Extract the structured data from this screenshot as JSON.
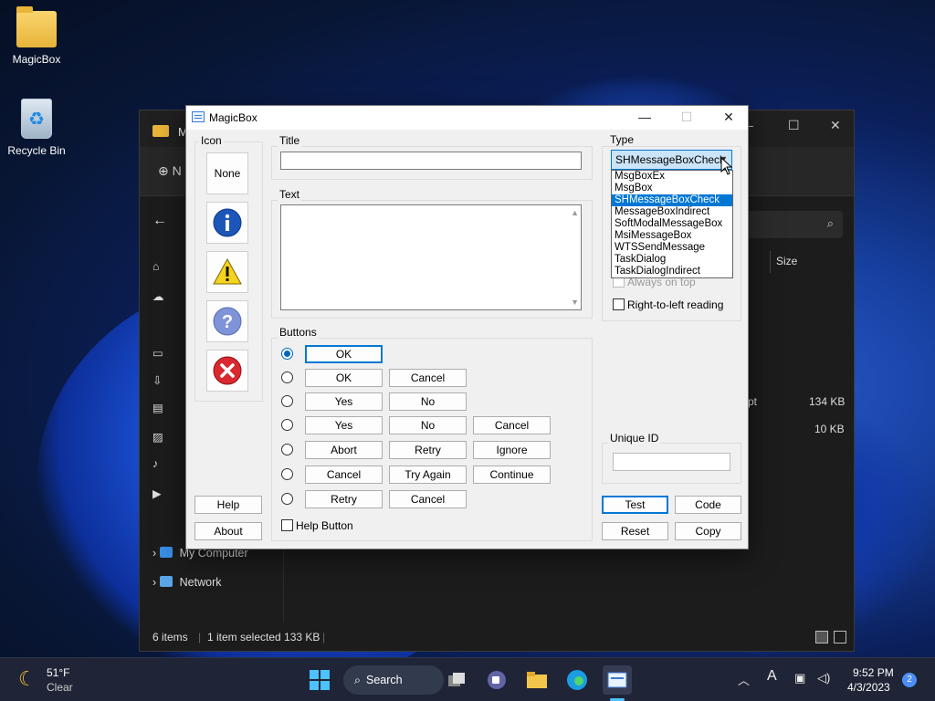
{
  "desktop": {
    "icons": [
      {
        "label": "MagicBox"
      },
      {
        "label": "Recycle Bin"
      }
    ]
  },
  "explorer": {
    "tab_title": "M",
    "new_label": "N",
    "sidebar": [
      "My Computer",
      "Network"
    ],
    "column_size": "Size",
    "rows": [
      {
        "type_partial": "pt",
        "size": "134 KB"
      },
      {
        "type_partial": "",
        "size": "10 KB"
      }
    ],
    "status": {
      "items": "6 items",
      "selected": "1 item selected  133 KB"
    }
  },
  "dialog": {
    "title": "MagicBox",
    "icon_group": "Icon",
    "icon_buttons": [
      {
        "label": "None"
      },
      {
        "icon": "info-icon"
      },
      {
        "icon": "warning-icon"
      },
      {
        "icon": "question-icon"
      },
      {
        "icon": "error-icon"
      }
    ],
    "help_label": "Help",
    "about_label": "About",
    "title_group": "Title",
    "title_value": "",
    "text_group": "Text",
    "text_value": "",
    "buttons_group": "Buttons",
    "button_rows": [
      {
        "selected": true,
        "buttons": [
          "OK"
        ]
      },
      {
        "selected": false,
        "buttons": [
          "OK",
          "Cancel"
        ]
      },
      {
        "selected": false,
        "buttons": [
          "Yes",
          "No"
        ]
      },
      {
        "selected": false,
        "buttons": [
          "Yes",
          "No",
          "Cancel"
        ]
      },
      {
        "selected": false,
        "buttons": [
          "Abort",
          "Retry",
          "Ignore"
        ]
      },
      {
        "selected": false,
        "buttons": [
          "Cancel",
          "Try Again",
          "Continue"
        ]
      },
      {
        "selected": false,
        "buttons": [
          "Retry",
          "Cancel"
        ]
      }
    ],
    "help_button_label": "Help Button",
    "type_group": "Type",
    "type_selected": "SHMessageBoxCheck",
    "type_options": [
      "MsgBoxEx",
      "MsgBox",
      "SHMessageBoxCheck",
      "MessageBoxIndirect",
      "SoftModalMessageBox",
      "MsiMessageBox",
      "WTSSendMessage",
      "TaskDialog",
      "TaskDialogIndirect"
    ],
    "always_on_top_label": "Always on top",
    "rtl_label": "Right-to-left reading",
    "unique_id_group": "Unique ID",
    "unique_id_value": "",
    "test_label": "Test",
    "code_label": "Code",
    "reset_label": "Reset",
    "copy_label": "Copy"
  },
  "taskbar": {
    "weather_temp": "51°F",
    "weather_desc": "Clear",
    "search_label": "Search",
    "time": "9:52 PM",
    "date": "4/3/2023",
    "notification_count": "2"
  }
}
